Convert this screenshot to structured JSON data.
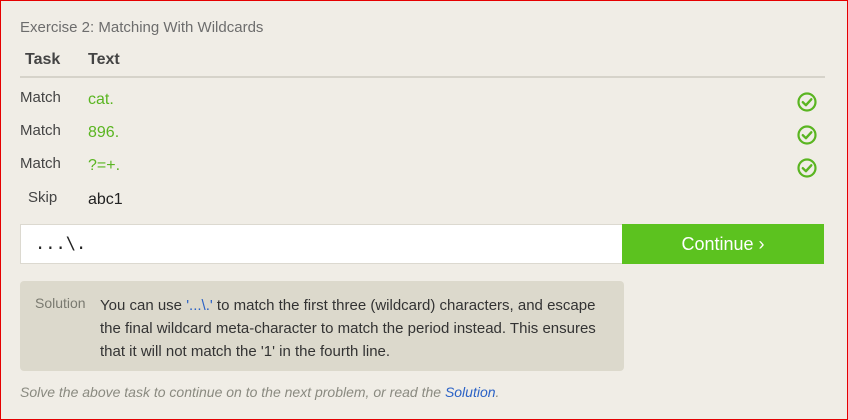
{
  "exercise": {
    "title": "Exercise 2: Matching With Wildcards"
  },
  "table": {
    "headers": {
      "task": "Task",
      "text": "Text"
    },
    "rows": [
      {
        "task": "Match",
        "text": "cat.",
        "status": "matched"
      },
      {
        "task": "Match",
        "text": "896.",
        "status": "matched"
      },
      {
        "task": "Match",
        "text": "?=+.",
        "status": "matched"
      },
      {
        "task": "Skip",
        "text": "abc1",
        "status": "skipped"
      }
    ]
  },
  "input": {
    "value": "...\\."
  },
  "continue_button": {
    "label": "Continue ›"
  },
  "solution": {
    "label": "Solution",
    "line_prefix": "You can use ",
    "code": "'...\\.'",
    "line_suffix": " to match the first three (wildcard) characters, and escape the final wildcard meta-character to match the period instead. This ensures that it will not match the '1' in the fourth line."
  },
  "footer": {
    "text": "Solve the above task to continue on to the next problem, or read the ",
    "link": "Solution",
    "end": "."
  },
  "colors": {
    "match_green": "#5ab521",
    "button_green": "#5cc21f",
    "link_blue": "#2b62c6",
    "frame_red": "#e60000"
  },
  "icons": {
    "row_status": "check-circle-icon"
  }
}
